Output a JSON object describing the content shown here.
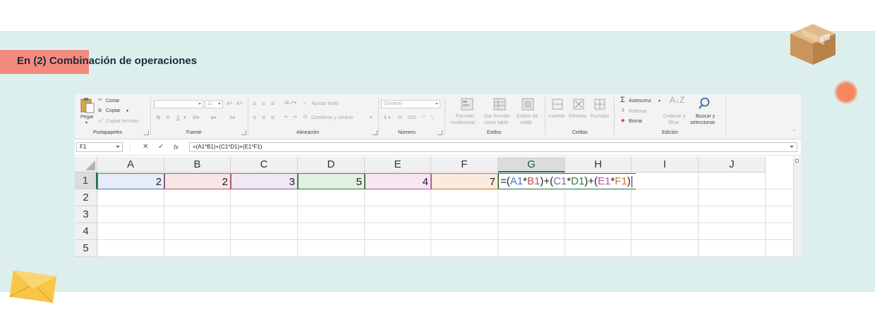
{
  "heading": "En (2) Combinación de operaciones",
  "ribbon": {
    "clipboard": {
      "paste": "Pegar",
      "cut": "Cortar",
      "copy": "Copiar",
      "format_painter": "Copiar formato",
      "group": "Portapapeles"
    },
    "font": {
      "size": "11",
      "group": "Fuente"
    },
    "alignment": {
      "wrap": "Ajustar texto",
      "merge": "Combinar y centrar",
      "group": "Alineación"
    },
    "number": {
      "format": "General",
      "group": "Número"
    },
    "styles": {
      "cond_1": "Formato",
      "cond_2": "condicional",
      "table_1": "Dar formato",
      "table_2": "como tabla",
      "cell_1": "Estilos de",
      "cell_2": "celda",
      "group": "Estilos"
    },
    "cells": {
      "insert": "Insertar",
      "delete": "Eliminar",
      "format": "Formato",
      "group": "Celdas"
    },
    "editing": {
      "autosum": "Autosuma",
      "fill": "Rellenar",
      "clear": "Borrar",
      "sort_1": "Ordenar y",
      "sort_2": "filtrar",
      "find_1": "Buscar y",
      "find_2": "seleccionar",
      "group": "Edición"
    }
  },
  "formula_bar": {
    "name_box": "F1",
    "formula": "=(A1*B1)+(C1*D1)+(E1*F1)"
  },
  "columns": [
    "A",
    "B",
    "C",
    "D",
    "E",
    "F",
    "G",
    "H",
    "I",
    "J"
  ],
  "rows": [
    "1",
    "2",
    "3",
    "4",
    "5"
  ],
  "cells": {
    "A1": "2",
    "B1": "2",
    "C1": "3",
    "D1": "5",
    "E1": "4",
    "F1": "7"
  },
  "cell_formula": {
    "open1": "=(",
    "a1": "A1",
    "mul1": "*",
    "b1": "B1",
    "close1": ")+(",
    "c1": "C1",
    "mul2": "*",
    "d1": "D1",
    "close2": ")+(",
    "e1": "E1",
    "mul3": "*",
    "f1": "F1",
    "close3": ")"
  },
  "colors": {
    "A1": "#4472c4",
    "B1": "#c0504d",
    "C1": "#8064a2",
    "D1": "#2e7d32",
    "E1": "#b4559a",
    "F1": "#e0701f",
    "excel_green": "#217346",
    "panel": "#dcefed",
    "tab": "#f28b7d"
  }
}
